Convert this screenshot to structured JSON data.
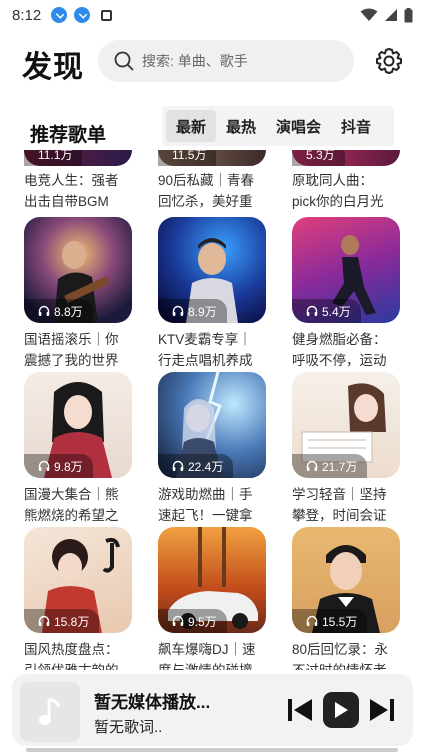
{
  "status_bar": {
    "time": "8:12"
  },
  "header": {
    "title": "发现",
    "search_placeholder": "搜索: 单曲、歌手"
  },
  "section": {
    "title": "推荐歌单",
    "tabs": [
      "最新",
      "最热",
      "演唱会",
      "抖音"
    ],
    "active_tab": "最新"
  },
  "playlists_partial": [
    {
      "plays": "11.1万",
      "title": "电竞人生：强者出击自带BGM"
    },
    {
      "plays": "11.5万",
      "title": "90后私藏｜青春回忆杀，美好重"
    },
    {
      "plays": "5.3万",
      "title": "原耽同人曲：pick你的白月光"
    }
  ],
  "playlists": [
    {
      "plays": "8.8万",
      "title": "国语摇滚乐｜你震撼了我的世界",
      "theme": "concert"
    },
    {
      "plays": "8.9万",
      "title": "KTV麦霸专享｜行走点唱机养成",
      "theme": "singer"
    },
    {
      "plays": "5.4万",
      "title": "健身燃脂必备：呼吸不停，运动",
      "theme": "fitness"
    },
    {
      "plays": "9.8万",
      "title": "国漫大集合｜熊熊燃烧的希望之",
      "theme": "anime"
    },
    {
      "plays": "22.4万",
      "title": "游戏助燃曲｜手速起飞！一键拿",
      "theme": "game"
    },
    {
      "plays": "21.7万",
      "title": "学习轻音｜坚持攀登，时间会证",
      "theme": "study"
    },
    {
      "plays": "15.8万",
      "title": "国风热度盘点：引领优雅古韵的",
      "theme": "guofeng"
    },
    {
      "plays": "9.5万",
      "title": "飙车爆嗨DJ｜速度与激情的碰撞",
      "theme": "car"
    },
    {
      "plays": "15.5万",
      "title": "80后回忆录：永不过时的情怀老",
      "theme": "retro"
    }
  ],
  "player": {
    "title": "暂无媒体播放...",
    "lyric": "暂无歌词.."
  }
}
